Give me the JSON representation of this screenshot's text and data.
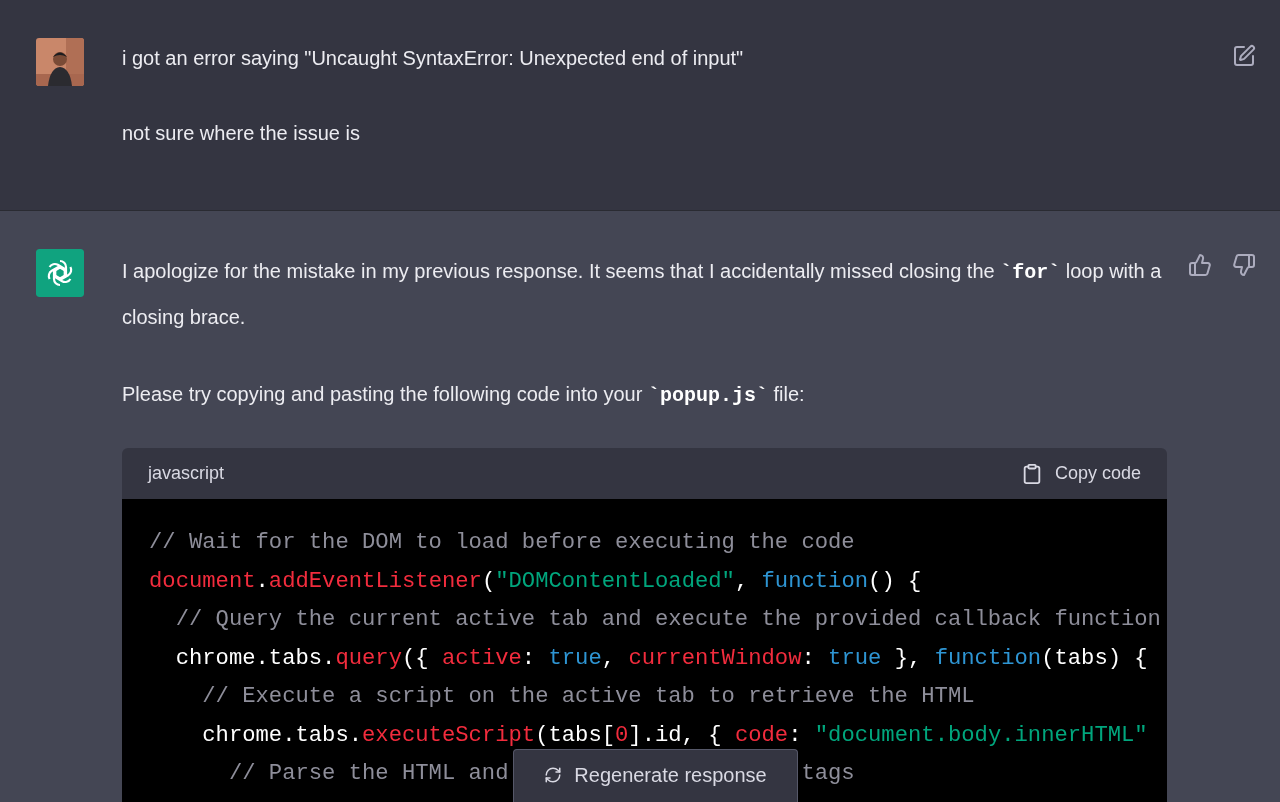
{
  "user_message": {
    "paragraphs": [
      "i got an error saying \"Uncaught SyntaxError: Unexpected end of input\"",
      "not sure where the issue is"
    ]
  },
  "assistant_message": {
    "paragraphs": [
      "I apologize for the mistake in my previous response. It seems that I accidentally missed closing the **`for`** loop with a closing brace.",
      "Please try copying and pasting the following code into your **`popup.js`** file:"
    ],
    "code_block": {
      "language": "javascript",
      "copy_label": "Copy code",
      "lines": [
        [
          {
            "kind": "comment",
            "text": "// Wait for the DOM to load before executing the code"
          }
        ],
        [
          {
            "kind": "name",
            "text": "document"
          },
          {
            "kind": "plain",
            "text": "."
          },
          {
            "kind": "name",
            "text": "addEventListener"
          },
          {
            "kind": "plain",
            "text": "("
          },
          {
            "kind": "string",
            "text": "\"DOMContentLoaded\""
          },
          {
            "kind": "plain",
            "text": ", "
          },
          {
            "kind": "keyword",
            "text": "function"
          },
          {
            "kind": "plain",
            "text": "() {"
          }
        ],
        [
          {
            "kind": "comment",
            "text": "  // Query the current active tab and execute the provided callback function"
          }
        ],
        [
          {
            "kind": "plain",
            "text": "  chrome.tabs."
          },
          {
            "kind": "name",
            "text": "query"
          },
          {
            "kind": "plain",
            "text": "({ "
          },
          {
            "kind": "name",
            "text": "active"
          },
          {
            "kind": "plain",
            "text": ": "
          },
          {
            "kind": "keyword",
            "text": "true"
          },
          {
            "kind": "plain",
            "text": ", "
          },
          {
            "kind": "name",
            "text": "currentWindow"
          },
          {
            "kind": "plain",
            "text": ": "
          },
          {
            "kind": "keyword",
            "text": "true"
          },
          {
            "kind": "plain",
            "text": " }, "
          },
          {
            "kind": "keyword",
            "text": "function"
          },
          {
            "kind": "plain",
            "text": "(tabs) {"
          }
        ],
        [
          {
            "kind": "comment",
            "text": "    // Execute a script on the active tab to retrieve the HTML"
          }
        ],
        [
          {
            "kind": "plain",
            "text": "    chrome.tabs."
          },
          {
            "kind": "name",
            "text": "executeScript"
          },
          {
            "kind": "plain",
            "text": "(tabs["
          },
          {
            "kind": "name",
            "text": "0"
          },
          {
            "kind": "plain",
            "text": "].id, { "
          },
          {
            "kind": "name",
            "text": "code"
          },
          {
            "kind": "plain",
            "text": ": "
          },
          {
            "kind": "string",
            "text": "\"document.body.innerHTML\""
          }
        ],
        [
          {
            "kind": "comment",
            "text": "      // Parse the HTML and"
          },
          {
            "kind": "comment_after_cover",
            "text": "tags"
          }
        ]
      ]
    }
  },
  "regenerate_button": {
    "label": "Regenerate response"
  }
}
